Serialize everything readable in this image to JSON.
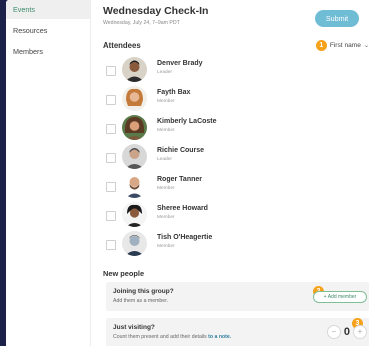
{
  "sidebar": {
    "items": [
      {
        "label": "Events",
        "active": true
      },
      {
        "label": "Resources",
        "active": false
      },
      {
        "label": "Members",
        "active": false
      }
    ]
  },
  "header": {
    "title": "Wednesday Check-In",
    "subtitle": "Wednesday, July 24, 7–9am PDT",
    "submit_label": "Submit"
  },
  "attendees": {
    "heading": "Attendees",
    "sort_badge": "1",
    "sort_label": "First name",
    "people": [
      {
        "name": "Denver Brady",
        "role": "Leader",
        "checked": false
      },
      {
        "name": "Fayth Bax",
        "role": "Member",
        "checked": false
      },
      {
        "name": "Kimberly LaCoste",
        "role": "Member",
        "checked": false
      },
      {
        "name": "Richie Course",
        "role": "Leader",
        "checked": false
      },
      {
        "name": "Roger Tanner",
        "role": "Member",
        "checked": false
      },
      {
        "name": "Sheree Howard",
        "role": "Member",
        "checked": false
      },
      {
        "name": "Tish O'Heagertie",
        "role": "Member",
        "checked": false
      }
    ]
  },
  "new_people": {
    "heading": "New people",
    "join": {
      "title": "Joining this group?",
      "subtitle": "Add them as a member.",
      "badge": "2",
      "button_label": "+ Add member"
    },
    "visit": {
      "title": "Just visiting?",
      "subtitle_prefix": "Count them present and add their details ",
      "subtitle_link": "to a note.",
      "badge": "3",
      "count": "0",
      "minus": "−",
      "plus": "+"
    }
  },
  "colors": {
    "accent": "#6fbcd5",
    "badge": "#f5a21a",
    "active_nav": "#3d8c6d",
    "background": "#1b2149"
  }
}
